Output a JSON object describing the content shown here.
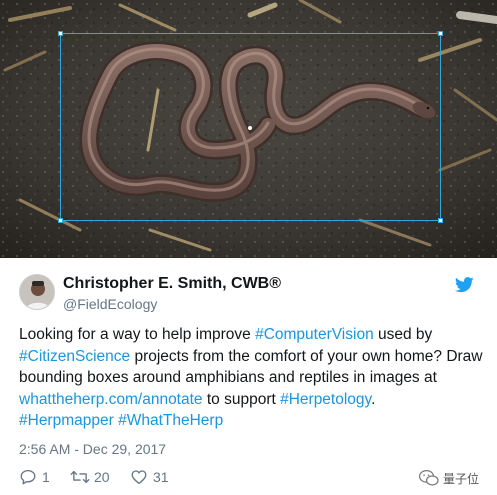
{
  "image": {
    "subject": "snake on ground",
    "icons": {
      "corner_handle": "bbox-handle-icon",
      "center": "center-dot-icon"
    }
  },
  "tweet": {
    "author_name": "Christopher E. Smith, CWB®",
    "author_handle": "@FieldEcology",
    "body": {
      "p1": "Looking for a way to help improve ",
      "l1": "#ComputerVision",
      "p2": " used by ",
      "l2": "#CitizenScience",
      "p3": " projects from the comfort of your own home? Draw bounding boxes around amphibians and reptiles in images at ",
      "l3": "whattheherp.com/annotate",
      "p4": " to support ",
      "l4": "#Herpetology",
      "p5": ".",
      "l5": "#Herpmapper",
      "p6": " ",
      "l6": "#WhatTheHerp"
    },
    "timestamp": "2:56 AM - Dec 29, 2017",
    "actions": {
      "reply_count": "1",
      "retweet_count": "20",
      "like_count": "31"
    },
    "watermark": "量子位"
  },
  "colors": {
    "link": "#1b95e0",
    "bbox": "#31a9d6",
    "secondary_text": "#657786",
    "twitter_blue": "#1da1f2"
  },
  "icons": {
    "brand": "twitter-bird-icon",
    "reply": "reply-icon",
    "retweet": "retweet-icon",
    "like": "heart-icon",
    "watermark": "wechat-icon"
  }
}
